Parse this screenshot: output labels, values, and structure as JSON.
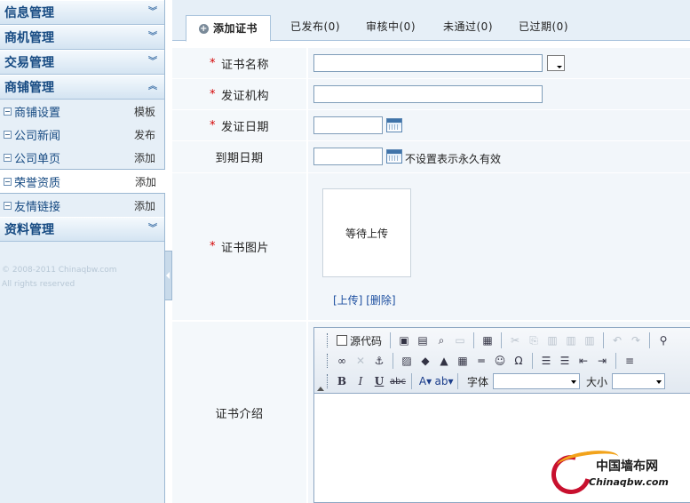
{
  "sidebar": {
    "sections": [
      {
        "title": "信息管理",
        "expanded": false
      },
      {
        "title": "商机管理",
        "expanded": false
      },
      {
        "title": "交易管理",
        "expanded": false
      },
      {
        "title": "商铺管理",
        "expanded": true
      },
      {
        "title": "资料管理",
        "expanded": false
      }
    ],
    "shop_items": [
      {
        "label": "商铺设置",
        "action": "模板"
      },
      {
        "label": "公司新闻",
        "action": "发布"
      },
      {
        "label": "公司单页",
        "action": "添加"
      },
      {
        "label": "荣誉资质",
        "action": "添加",
        "active": true
      },
      {
        "label": "友情链接",
        "action": "添加"
      }
    ],
    "copyright_line1": "© 2008-2011 Chinaqbw.com",
    "copyright_line2": "All rights reserved"
  },
  "tabs": [
    {
      "label": "添加证书",
      "active": true
    },
    {
      "label": "已发布(0)"
    },
    {
      "label": "审核中(0)"
    },
    {
      "label": "未通过(0)"
    },
    {
      "label": "已过期(0)"
    }
  ],
  "form": {
    "required_mark": "*",
    "cert_name_label": "证书名称",
    "cert_name_value": "",
    "issuer_label": "发证机构",
    "issuer_value": "",
    "issue_date_label": "发证日期",
    "issue_date_value": "",
    "expire_date_label": "到期日期",
    "expire_date_value": "",
    "expire_hint": "不设置表示永久有效",
    "image_label": "证书图片",
    "image_placeholder": "等待上传",
    "upload_link": "[上传]",
    "delete_link": "[删除]",
    "intro_label": "证书介绍"
  },
  "editor": {
    "source_label": "源代码",
    "font_label": "字体",
    "size_label": "大小",
    "font_value": "",
    "size_value": ""
  },
  "watermark": {
    "cn": "中国墙布网",
    "en": "Chinaqbw.com"
  }
}
